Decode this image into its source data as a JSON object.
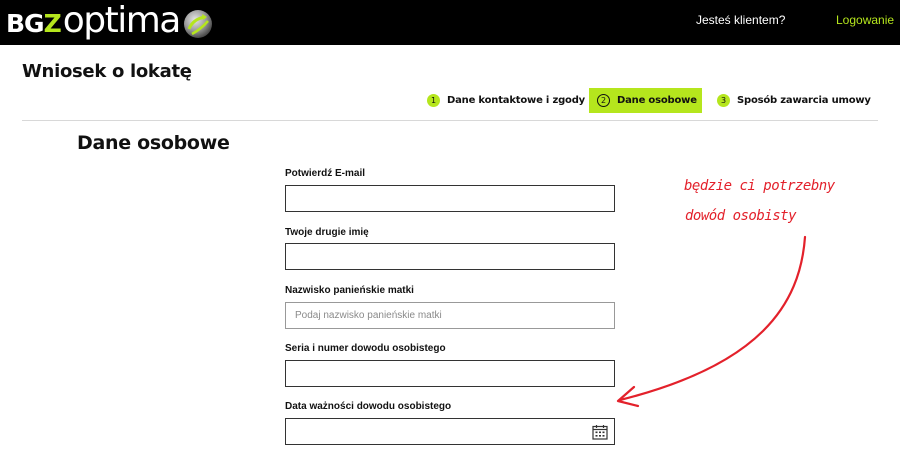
{
  "header": {
    "logo_prefix": "BG",
    "logo_accent": "Z",
    "logo_suffix": "optima",
    "client_link": "Jesteś klientem?",
    "login_link": "Logowanie"
  },
  "page": {
    "title": "Wniosek o lokatę",
    "section_title": "Dane osobowe"
  },
  "steps": [
    {
      "number": "1",
      "label": "Dane kontaktowe i zgody",
      "state": "done"
    },
    {
      "number": "2",
      "label": "Dane osobowe",
      "state": "active"
    },
    {
      "number": "3",
      "label": "Sposób zawarcia umowy",
      "state": "upcoming"
    }
  ],
  "form": {
    "fields": [
      {
        "label": "Potwierdź E-mail",
        "value": "",
        "placeholder": ""
      },
      {
        "label": "Twoje drugie imię",
        "value": "",
        "placeholder": ""
      },
      {
        "label": "Nazwisko panieńskie matki",
        "value": "",
        "placeholder": "Podaj nazwisko panieńskie matki"
      },
      {
        "label": "Seria i numer dowodu osobistego",
        "value": "",
        "placeholder": ""
      },
      {
        "label": "Data ważności dowodu osobistego",
        "value": "",
        "placeholder": ""
      }
    ]
  },
  "annotation": {
    "line1": "będzie ci potrzebny",
    "line2": "dowód osobisty"
  },
  "colors": {
    "accent": "#b5e61d",
    "topbar": "#000000",
    "annotation": "#e3212b"
  },
  "icons": {
    "logo_ball": "globe-ball-icon",
    "calendar": "calendar-icon",
    "arrow": "curved-arrow-icon"
  }
}
